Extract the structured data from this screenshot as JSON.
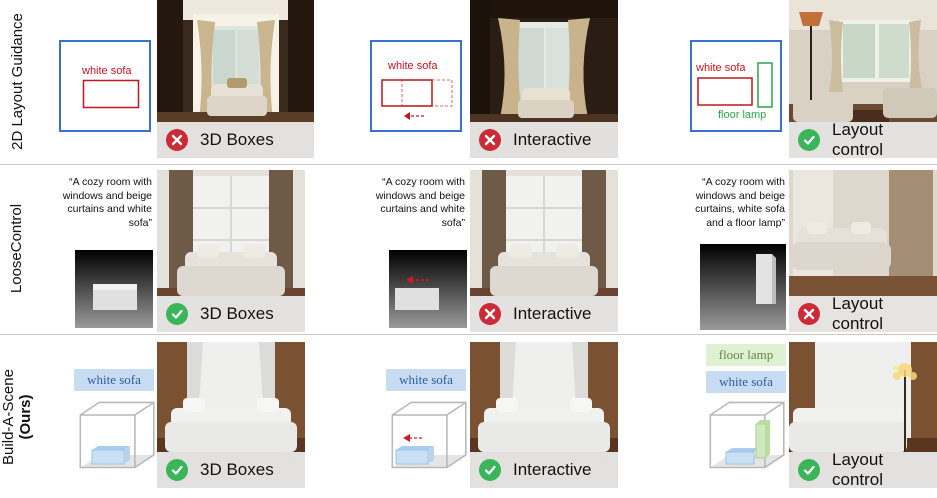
{
  "rows": [
    {
      "label": "2D Layout Guidance",
      "label2": ""
    },
    {
      "label": "LooseControl",
      "label2": ""
    },
    {
      "label": "Build-A-Scene",
      "label2": "(Ours)"
    }
  ],
  "captions": {
    "boxes": "3D Boxes",
    "interactive": "Interactive",
    "layout": "Layout control"
  },
  "labels": {
    "white_sofa": "white sofa",
    "floor_lamp": "floor lamp"
  },
  "prompts": {
    "p1": "“A cozy room with windows and beige curtains and white sofa”",
    "p2": "“A cozy room with windows and beige curtains and white sofa”",
    "p3": "“A cozy room with windows and beige curtains, white sofa and a floor lamp”"
  },
  "results": {
    "r1": [
      "fail",
      "fail",
      "success"
    ],
    "r2": [
      "success",
      "fail",
      "fail"
    ],
    "r3": [
      "success",
      "success",
      "success"
    ]
  },
  "colors": {
    "success": "#3bb55a",
    "fail": "#cc2a36",
    "box_blue": "#3b6fd0",
    "sofa_red": "#c0161d",
    "lamp_green": "#2aa64a"
  }
}
